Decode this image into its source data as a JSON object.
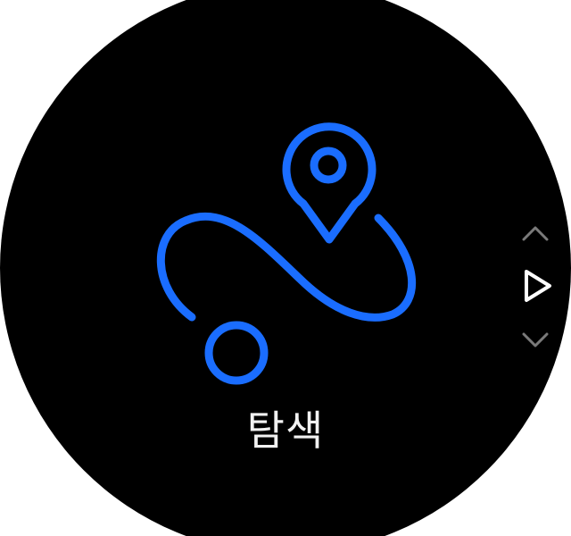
{
  "screen": {
    "menu_label": "탐색",
    "icon": "route-navigation-icon",
    "accent_color": "#1a6dff",
    "background_color": "#000000",
    "text_color": "#f2f2f2",
    "control_color": "#7a7a7a",
    "select_color": "#ffffff"
  },
  "controls": {
    "up": "chevron-up-icon",
    "select": "play-triangle-icon",
    "down": "chevron-down-icon"
  }
}
